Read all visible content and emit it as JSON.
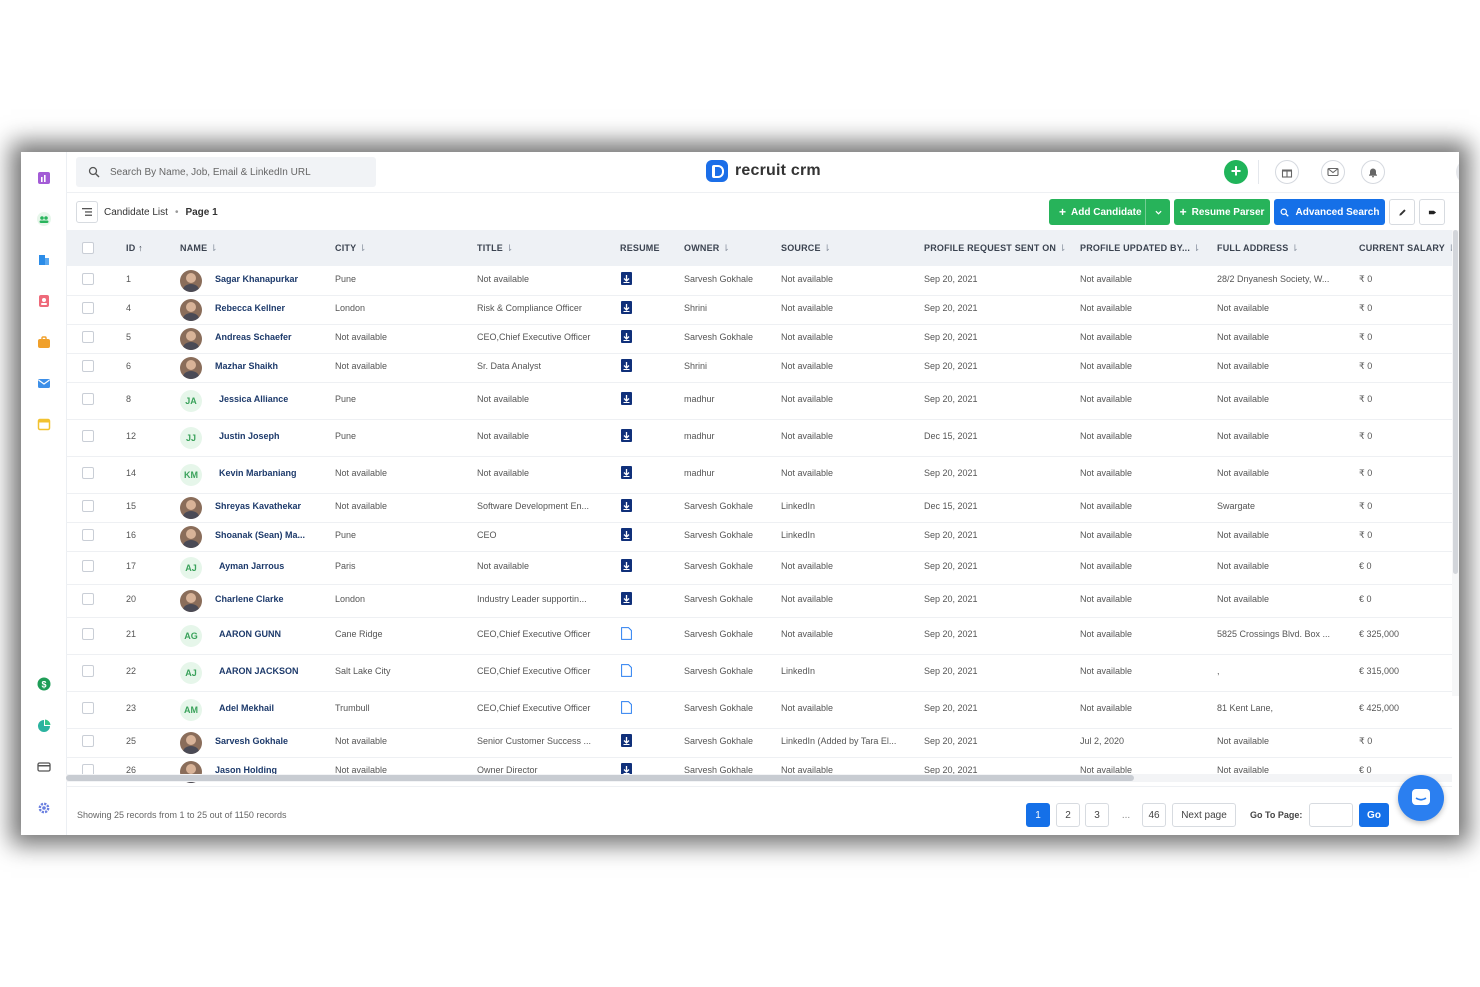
{
  "app": {
    "logo_text": "recruit crm",
    "brand_color": "#1b6ee8"
  },
  "search": {
    "placeholder": "Search By Name, Job, Email & LinkedIn URL"
  },
  "breadcrumb": {
    "root": "Candidate List",
    "current": "Page 1"
  },
  "toolbar": {
    "add_candidate": "Add Candidate",
    "resume_parser": "Resume Parser",
    "advanced_search": "Advanced Search"
  },
  "sidebar": {
    "icons": [
      "dashboard-icon",
      "candidates-icon",
      "companies-icon",
      "contacts-icon",
      "jobs-icon",
      "email-icon",
      "calendar-icon",
      "billing-icon",
      "reports-icon",
      "card-icon",
      "settings-icon"
    ]
  },
  "table": {
    "headers": {
      "id": "ID",
      "name": "NAME",
      "city": "CITY",
      "title": "TITLE",
      "resume": "RESUME",
      "owner": "OWNER",
      "source": "SOURCE",
      "profile_request": "PROFILE REQUEST SENT ON",
      "profile_updated": "PROFILE UPDATED BY...",
      "full_address": "FULL ADDRESS",
      "current_salary": "CURRENT SALARY"
    },
    "rows": [
      {
        "id": "1",
        "name": "Sagar Khanapurkar",
        "avatar": "photo",
        "initials": "",
        "city": "Pune",
        "title": "Not available",
        "resume": "filled",
        "owner": "Sarvesh Gokhale",
        "source": "Not available",
        "req": "Sep 20, 2021",
        "upd": "Not available",
        "addr": "28/2 Dnyanesh Society, W...",
        "salary": "₹ 0"
      },
      {
        "id": "4",
        "name": "Rebecca Kellner",
        "avatar": "photo",
        "initials": "",
        "city": "London",
        "title": "Risk & Compliance Officer",
        "resume": "filled",
        "owner": "Shrini",
        "source": "Not available",
        "req": "Sep 20, 2021",
        "upd": "Not available",
        "addr": "Not available",
        "salary": "₹ 0"
      },
      {
        "id": "5",
        "name": "Andreas Schaefer",
        "avatar": "photo",
        "initials": "",
        "city": "Not available",
        "title": "CEO,Chief Executive Officer",
        "resume": "filled",
        "owner": "Sarvesh Gokhale",
        "source": "Not available",
        "req": "Sep 20, 2021",
        "upd": "Not available",
        "addr": "Not available",
        "salary": "₹ 0"
      },
      {
        "id": "6",
        "name": "Mazhar Shaikh",
        "avatar": "photo",
        "initials": "",
        "city": "Not available",
        "title": "Sr. Data Analyst",
        "resume": "filled",
        "owner": "Shrini",
        "source": "Not available",
        "req": "Sep 20, 2021",
        "upd": "Not available",
        "addr": "Not available",
        "salary": "₹ 0"
      },
      {
        "id": "8",
        "name": "Jessica Alliance",
        "avatar": "initials",
        "initials": "JA",
        "city": "Pune",
        "title": "Not available",
        "resume": "filled",
        "owner": "madhur",
        "source": "Not available",
        "req": "Sep 20, 2021",
        "upd": "Not available",
        "addr": "Not available",
        "salary": "₹ 0"
      },
      {
        "id": "12",
        "name": "Justin Joseph",
        "avatar": "initials",
        "initials": "JJ",
        "city": "Pune",
        "title": "Not available",
        "resume": "filled",
        "owner": "madhur",
        "source": "Not available",
        "req": "Dec 15, 2021",
        "upd": "Not available",
        "addr": "Not available",
        "salary": "₹ 0"
      },
      {
        "id": "14",
        "name": "Kevin Marbaniang",
        "avatar": "initials",
        "initials": "KM",
        "city": "Not available",
        "title": "Not available",
        "resume": "filled",
        "owner": "madhur",
        "source": "Not available",
        "req": "Sep 20, 2021",
        "upd": "Not available",
        "addr": "Not available",
        "salary": "₹ 0"
      },
      {
        "id": "15",
        "name": "Shreyas Kavathekar",
        "avatar": "photo",
        "initials": "",
        "city": "Not available",
        "title": "Software Development En...",
        "resume": "filled",
        "owner": "Sarvesh Gokhale",
        "source": "LinkedIn",
        "req": "Dec 15, 2021",
        "upd": "Not available",
        "addr": "Swargate",
        "salary": "₹ 0"
      },
      {
        "id": "16",
        "name": "Shoanak (Sean) Ma...",
        "avatar": "photo",
        "initials": "",
        "city": "Pune",
        "title": "CEO",
        "resume": "filled",
        "owner": "Sarvesh Gokhale",
        "source": "LinkedIn",
        "req": "Sep 20, 2021",
        "upd": "Not available",
        "addr": "Not available",
        "salary": "₹ 0"
      },
      {
        "id": "17",
        "name": "Ayman Jarrous",
        "avatar": "initials",
        "initials": "AJ",
        "city": "Paris",
        "title": "Not available",
        "resume": "filled",
        "owner": "Sarvesh Gokhale",
        "source": "Not available",
        "req": "Sep 20, 2021",
        "upd": "Not available",
        "addr": "Not available",
        "salary": "€ 0"
      },
      {
        "id": "20",
        "name": "Charlene Clarke",
        "avatar": "photo",
        "initials": "",
        "city": "London",
        "title": "Industry Leader supportin...",
        "resume": "filled",
        "owner": "Sarvesh Gokhale",
        "source": "Not available",
        "req": "Sep 20, 2021",
        "upd": "Not available",
        "addr": "Not available",
        "salary": "€ 0"
      },
      {
        "id": "21",
        "name": "AARON GUNN",
        "avatar": "initials",
        "initials": "AG",
        "city": "Cane Ridge",
        "title": "CEO,Chief Executive Officer",
        "resume": "outline",
        "owner": "Sarvesh Gokhale",
        "source": "Not available",
        "req": "Sep 20, 2021",
        "upd": "Not available",
        "addr": "5825 Crossings Blvd. Box ...",
        "salary": "€ 325,000"
      },
      {
        "id": "22",
        "name": "AARON JACKSON",
        "avatar": "initials",
        "initials": "AJ",
        "city": "Salt Lake City",
        "title": "CEO,Chief Executive Officer",
        "resume": "outline",
        "owner": "Sarvesh Gokhale",
        "source": "LinkedIn",
        "req": "Sep 20, 2021",
        "upd": "Not available",
        "addr": ",",
        "salary": "€ 315,000"
      },
      {
        "id": "23",
        "name": "Adel Mekhail",
        "avatar": "initials",
        "initials": "AM",
        "city": "Trumbull",
        "title": "CEO,Chief Executive Officer",
        "resume": "outline",
        "owner": "Sarvesh Gokhale",
        "source": "Not available",
        "req": "Sep 20, 2021",
        "upd": "Not available",
        "addr": "81 Kent Lane,",
        "salary": "€ 425,000"
      },
      {
        "id": "25",
        "name": "Sarvesh Gokhale",
        "avatar": "photo",
        "initials": "",
        "city": "Not available",
        "title": "Senior Customer Success ...",
        "resume": "filled",
        "owner": "Sarvesh Gokhale",
        "source": "LinkedIn (Added by Tara El...",
        "req": "Sep 20, 2021",
        "upd": "Jul 2, 2020",
        "addr": "Not available",
        "salary": "₹ 0"
      },
      {
        "id": "26",
        "name": "Jason Holding",
        "avatar": "photo",
        "initials": "",
        "city": "Not available",
        "title": "Owner Director",
        "resume": "filled",
        "owner": "Sarvesh Gokhale",
        "source": "Not available",
        "req": "Sep 20, 2021",
        "upd": "Not available",
        "addr": "Not available",
        "salary": "€ 0"
      }
    ]
  },
  "footer": {
    "summary": "Showing 25 records from 1 to 25 out of 1150 records",
    "pages": [
      "1",
      "2",
      "3",
      "...",
      "46"
    ],
    "next": "Next page",
    "goto_label": "Go To Page:",
    "go": "Go"
  }
}
